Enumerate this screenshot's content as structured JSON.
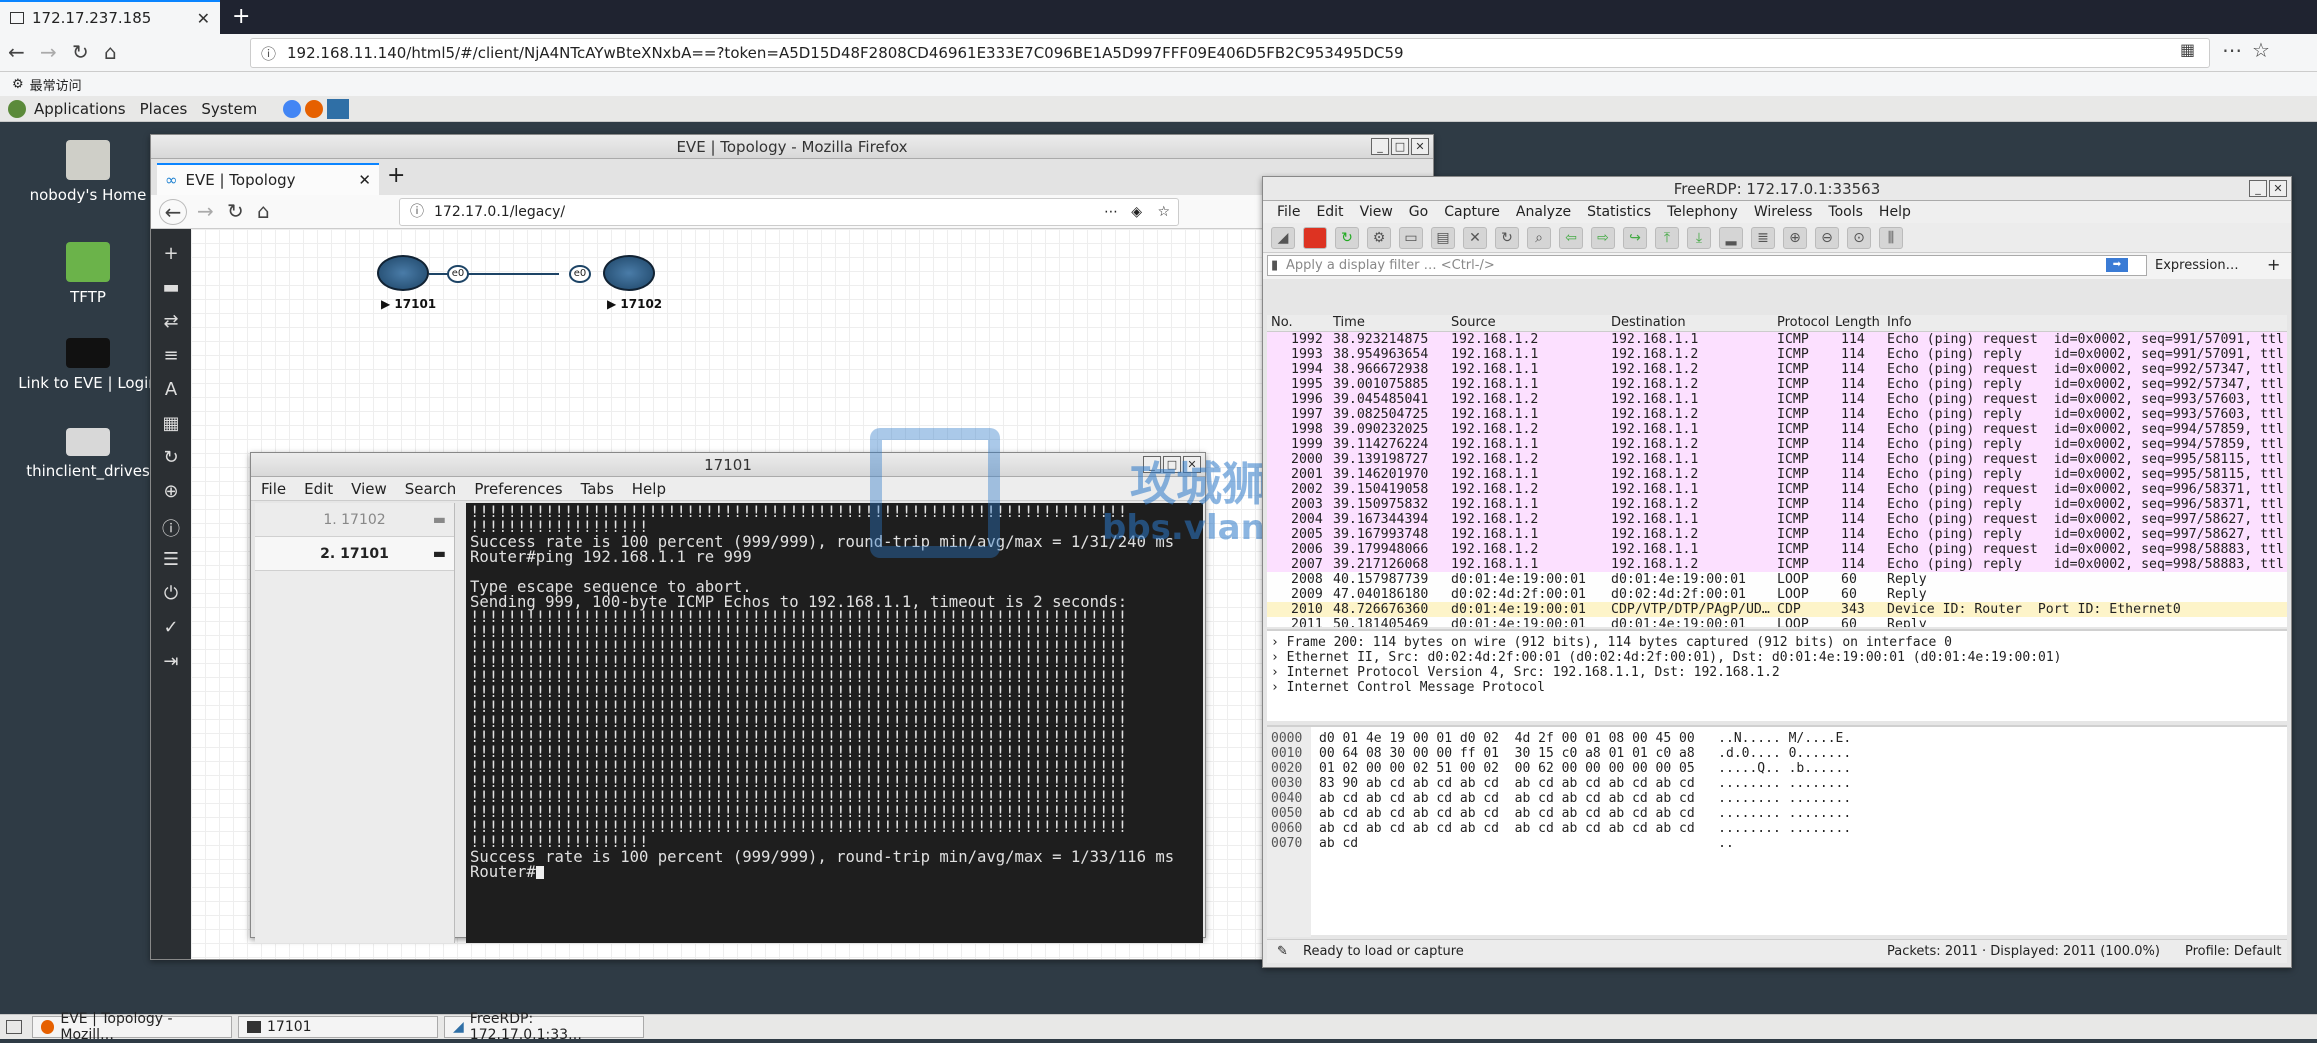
{
  "outer_browser": {
    "tab_title": "172.17.237.185",
    "url": "192.168.11.140/html5/#/client/NjA4NTcAYwBteXNxbA==?token=A5D15D48F2808CD46961E333E7C096BE1A5D997FFF09E406D5FB2C953495DC59",
    "bookmark": "最常访问"
  },
  "gnome_panel": {
    "applications": "Applications",
    "places": "Places",
    "system": "System"
  },
  "desktop_icons": [
    "nobody's Home",
    "TFTP",
    "Link to EVE | Login",
    "thinclient_drives"
  ],
  "eve": {
    "window_title": "EVE | Topology - Mozilla Firefox",
    "tab_title": "EVE | Topology",
    "url": "172.17.0.1/legacy/",
    "node1": "17101",
    "node2": "17102",
    "port1": "e0",
    "port2": "e0",
    "badge": "N"
  },
  "terminal": {
    "title": "17101",
    "menu": [
      "File",
      "Edit",
      "View",
      "Search",
      "Preferences",
      "Tabs",
      "Help"
    ],
    "sessions": [
      "1. 17102",
      "2. 17101"
    ],
    "lines": [
      "!!!!!!!!!!!!!!!!!!!!!!!!!!!!!!!!!!!!!!!!!!!!!!!!!!!!!!!!!!!!!!!!!!!!!!",
      "!!!!!!!!!!!!!!!!!!!",
      "Success rate is 100 percent (999/999), round-trip min/avg/max = 1/31/240 ms",
      "Router#ping 192.168.1.1 re 999",
      "",
      "Type escape sequence to abort.",
      "Sending 999, 100-byte ICMP Echos to 192.168.1.1, timeout is 2 seconds:",
      "!!!!!!!!!!!!!!!!!!!!!!!!!!!!!!!!!!!!!!!!!!!!!!!!!!!!!!!!!!!!!!!!!!!!!!",
      "!!!!!!!!!!!!!!!!!!!!!!!!!!!!!!!!!!!!!!!!!!!!!!!!!!!!!!!!!!!!!!!!!!!!!!",
      "!!!!!!!!!!!!!!!!!!!!!!!!!!!!!!!!!!!!!!!!!!!!!!!!!!!!!!!!!!!!!!!!!!!!!!",
      "!!!!!!!!!!!!!!!!!!!!!!!!!!!!!!!!!!!!!!!!!!!!!!!!!!!!!!!!!!!!!!!!!!!!!!",
      "!!!!!!!!!!!!!!!!!!!!!!!!!!!!!!!!!!!!!!!!!!!!!!!!!!!!!!!!!!!!!!!!!!!!!!",
      "!!!!!!!!!!!!!!!!!!!!!!!!!!!!!!!!!!!!!!!!!!!!!!!!!!!!!!!!!!!!!!!!!!!!!!",
      "!!!!!!!!!!!!!!!!!!!!!!!!!!!!!!!!!!!!!!!!!!!!!!!!!!!!!!!!!!!!!!!!!!!!!!",
      "!!!!!!!!!!!!!!!!!!!!!!!!!!!!!!!!!!!!!!!!!!!!!!!!!!!!!!!!!!!!!!!!!!!!!!",
      "!!!!!!!!!!!!!!!!!!!!!!!!!!!!!!!!!!!!!!!!!!!!!!!!!!!!!!!!!!!!!!!!!!!!!!",
      "!!!!!!!!!!!!!!!!!!!!!!!!!!!!!!!!!!!!!!!!!!!!!!!!!!!!!!!!!!!!!!!!!!!!!!",
      "!!!!!!!!!!!!!!!!!!!!!!!!!!!!!!!!!!!!!!!!!!!!!!!!!!!!!!!!!!!!!!!!!!!!!!",
      "!!!!!!!!!!!!!!!!!!!!!!!!!!!!!!!!!!!!!!!!!!!!!!!!!!!!!!!!!!!!!!!!!!!!!!",
      "!!!!!!!!!!!!!!!!!!!!!!!!!!!!!!!!!!!!!!!!!!!!!!!!!!!!!!!!!!!!!!!!!!!!!!",
      "!!!!!!!!!!!!!!!!!!!!!!!!!!!!!!!!!!!!!!!!!!!!!!!!!!!!!!!!!!!!!!!!!!!!!!",
      "!!!!!!!!!!!!!!!!!!!!!!!!!!!!!!!!!!!!!!!!!!!!!!!!!!!!!!!!!!!!!!!!!!!!!!",
      "!!!!!!!!!!!!!!!!!!!",
      "Success rate is 100 percent (999/999), round-trip min/avg/max = 1/33/116 ms",
      "Router#"
    ]
  },
  "wireshark": {
    "title": "FreeRDP: 172.17.0.1:33563",
    "menu": [
      "File",
      "Edit",
      "View",
      "Go",
      "Capture",
      "Analyze",
      "Statistics",
      "Telephony",
      "Wireless",
      "Tools",
      "Help"
    ],
    "filter_placeholder": "Apply a display filter … <Ctrl-/>",
    "expression": "Expression…",
    "columns": [
      "No.",
      "Time",
      "Source",
      "Destination",
      "Protocol",
      "Length",
      "Info"
    ],
    "packets": [
      [
        "1992",
        "38.923214875",
        "192.168.1.2",
        "192.168.1.1",
        "ICMP",
        "114",
        "Echo (ping) request  id=0x0002, seq=991/57091, ttl",
        "icmp"
      ],
      [
        "1993",
        "38.954963654",
        "192.168.1.1",
        "192.168.1.2",
        "ICMP",
        "114",
        "Echo (ping) reply    id=0x0002, seq=991/57091, ttl",
        "icmp"
      ],
      [
        "1994",
        "38.966672938",
        "192.168.1.1",
        "192.168.1.2",
        "ICMP",
        "114",
        "Echo (ping) request  id=0x0002, seq=992/57347, ttl",
        "icmp"
      ],
      [
        "1995",
        "39.001075885",
        "192.168.1.1",
        "192.168.1.2",
        "ICMP",
        "114",
        "Echo (ping) reply    id=0x0002, seq=992/57347, ttl",
        "icmp"
      ],
      [
        "1996",
        "39.045485041",
        "192.168.1.2",
        "192.168.1.1",
        "ICMP",
        "114",
        "Echo (ping) request  id=0x0002, seq=993/57603, ttl",
        "icmp"
      ],
      [
        "1997",
        "39.082504725",
        "192.168.1.1",
        "192.168.1.2",
        "ICMP",
        "114",
        "Echo (ping) reply    id=0x0002, seq=993/57603, ttl",
        "icmp"
      ],
      [
        "1998",
        "39.090232025",
        "192.168.1.2",
        "192.168.1.1",
        "ICMP",
        "114",
        "Echo (ping) request  id=0x0002, seq=994/57859, ttl",
        "icmp"
      ],
      [
        "1999",
        "39.114276224",
        "192.168.1.1",
        "192.168.1.2",
        "ICMP",
        "114",
        "Echo (ping) reply    id=0x0002, seq=994/57859, ttl",
        "icmp"
      ],
      [
        "2000",
        "39.139198727",
        "192.168.1.2",
        "192.168.1.1",
        "ICMP",
        "114",
        "Echo (ping) request  id=0x0002, seq=995/58115, ttl",
        "icmp"
      ],
      [
        "2001",
        "39.146201970",
        "192.168.1.1",
        "192.168.1.2",
        "ICMP",
        "114",
        "Echo (ping) reply    id=0x0002, seq=995/58115, ttl",
        "icmp"
      ],
      [
        "2002",
        "39.150419058",
        "192.168.1.2",
        "192.168.1.1",
        "ICMP",
        "114",
        "Echo (ping) request  id=0x0002, seq=996/58371, ttl",
        "icmp"
      ],
      [
        "2003",
        "39.150975832",
        "192.168.1.1",
        "192.168.1.2",
        "ICMP",
        "114",
        "Echo (ping) reply    id=0x0002, seq=996/58371, ttl",
        "icmp"
      ],
      [
        "2004",
        "39.167344394",
        "192.168.1.2",
        "192.168.1.1",
        "ICMP",
        "114",
        "Echo (ping) request  id=0x0002, seq=997/58627, ttl",
        "icmp"
      ],
      [
        "2005",
        "39.167993748",
        "192.168.1.1",
        "192.168.1.2",
        "ICMP",
        "114",
        "Echo (ping) reply    id=0x0002, seq=997/58627, ttl",
        "icmp"
      ],
      [
        "2006",
        "39.179948066",
        "192.168.1.2",
        "192.168.1.1",
        "ICMP",
        "114",
        "Echo (ping) request  id=0x0002, seq=998/58883, ttl",
        "icmp"
      ],
      [
        "2007",
        "39.217126068",
        "192.168.1.1",
        "192.168.1.2",
        "ICMP",
        "114",
        "Echo (ping) reply    id=0x0002, seq=998/58883, ttl",
        "icmp"
      ],
      [
        "2008",
        "40.157987739",
        "d0:01:4e:19:00:01",
        "d0:01:4e:19:00:01",
        "LOOP",
        "60",
        "Reply",
        "loop"
      ],
      [
        "2009",
        "47.040186180",
        "d0:02:4d:2f:00:01",
        "d0:02:4d:2f:00:01",
        "LOOP",
        "60",
        "Reply",
        "loop"
      ],
      [
        "2010",
        "48.726676360",
        "d0:01:4e:19:00:01",
        "CDP/VTP/DTP/PAgP/UD…",
        "CDP",
        "343",
        "Device ID: Router  Port ID: Ethernet0",
        "cdp"
      ],
      [
        "2011",
        "50.181405469",
        "d0:01:4e:19:00:01",
        "d0:01:4e:19:00:01",
        "LOOP",
        "60",
        "Reply",
        "loop"
      ]
    ],
    "details": [
      "Frame 200: 114 bytes on wire (912 bits), 114 bytes captured (912 bits) on interface 0",
      "Ethernet II, Src: d0:02:4d:2f:00:01 (d0:02:4d:2f:00:01), Dst: d0:01:4e:19:00:01 (d0:01:4e:19:00:01)",
      "Internet Protocol Version 4, Src: 192.168.1.1, Dst: 192.168.1.2",
      "Internet Control Message Protocol"
    ],
    "hex_offsets": [
      "0000",
      "0010",
      "0020",
      "0030",
      "0040",
      "0050",
      "0060",
      "0070"
    ],
    "hex_lines": [
      "d0 01 4e 19 00 01 d0 02  4d 2f 00 01 08 00 45 00   ..N..... M/....E.",
      "00 64 08 30 00 00 ff 01  30 15 c0 a8 01 01 c0 a8   .d.0.... 0.......",
      "01 02 00 00 02 51 00 02  00 62 00 00 00 00 00 05   .....Q.. .b......",
      "83 90 ab cd ab cd ab cd  ab cd ab cd ab cd ab cd   ........ ........",
      "ab cd ab cd ab cd ab cd  ab cd ab cd ab cd ab cd   ........ ........",
      "ab cd ab cd ab cd ab cd  ab cd ab cd ab cd ab cd   ........ ........",
      "ab cd ab cd ab cd ab cd  ab cd ab cd ab cd ab cd   ........ ........",
      "ab cd                                              .."
    ],
    "status_left": "Ready to load or capture",
    "status_mid": "Packets: 2011 · Displayed: 2011 (100.0%)",
    "status_right": "Profile: Default"
  },
  "taskbar": {
    "item1": "EVE | Topology - Mozill…",
    "item2": "17101",
    "item3": "FreeRDP: 172.17.0.1:33…"
  },
  "watermark": "攻城狮",
  "watermark_sub": "bbs.vlan"
}
